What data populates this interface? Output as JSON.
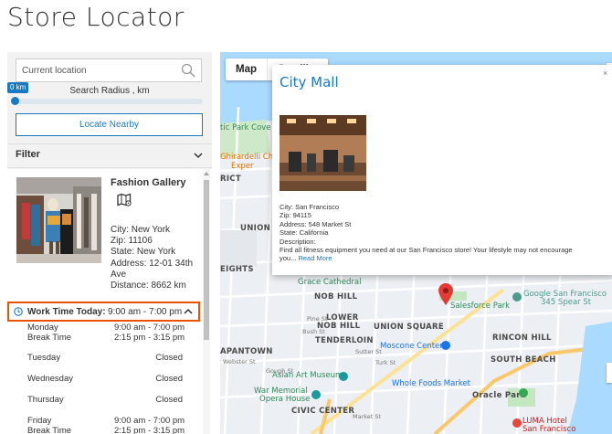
{
  "page": {
    "title": "Store Locator"
  },
  "search": {
    "placeholder": "Current location",
    "radius_value": "0 km",
    "radius_label": "Search Radius , km",
    "radius_fraction": 0.0,
    "locate_button": "Locate Nearby"
  },
  "filter": {
    "label": "Filter"
  },
  "store": {
    "name": "Fashion Gallery",
    "city": "City: New York",
    "zip": "Zip: 11106",
    "state": "State: New York",
    "address": "Address: 12-01 34th Ave",
    "distance": "Distance: 8662 km",
    "work_today_label": "Work Time Today:",
    "work_today_value": "9:00 am - 7:00 pm",
    "schedule": [
      {
        "day": "Monday",
        "hours": "9:00 am - 7:00 pm",
        "break_label": "Break Time",
        "break": "2:15 pm - 3:15 pm"
      },
      {
        "day": "Tuesday",
        "hours": "Closed"
      },
      {
        "day": "Wednesday",
        "hours": "Closed"
      },
      {
        "day": "Thursday",
        "hours": "Closed"
      },
      {
        "day": "Friday",
        "hours": "9:00 am - 7:00 pm",
        "break_label": "Break Time",
        "break": "2:15 pm - 3:15 pm"
      }
    ]
  },
  "map": {
    "tabs": [
      "Map",
      "Satellite"
    ],
    "info_window": {
      "title": "City Mall",
      "close": "×",
      "city": "City: San Francisco",
      "zip": "Zip: 94115",
      "address": "Address: 548 Market St",
      "state": "State: California",
      "description_label": "Description:",
      "description": "Find all fitness equipment you need at our San Francisco store! Your lifestyle may not encourage",
      "description_end": "you...",
      "read_more": "Read More"
    },
    "labels": {
      "palace": "tic Park Cove",
      "ghirardelli": "Ghirardelli Choc",
      "exp": "Exper",
      "rict": "RICT",
      "union": "UNION S",
      "heights": "EIGHTS",
      "cathedral": "Grace Cathedral",
      "nob_hill": "NOB HILL",
      "lower_nob_hill_1": "LOWER",
      "lower_nob_hill_2": "NOB HILL",
      "union_square": "UNION SQUARE",
      "tenderloin": "TENDERLOIN",
      "rincon_hill": "RINCON HILL",
      "salesforce": "Salesforce Park",
      "google_sf_1": "Google San Francisco",
      "google_sf_2": "345 Spear St",
      "moscone": "Moscone Center",
      "japantown": "APANTOWN",
      "south_beach": "SOUTH BEACH",
      "asian_art": "Asian Art Museum",
      "war_memorial_1": "War Memorial",
      "war_memorial_2": "Opera House",
      "whole_foods": "Whole Foods Market",
      "oracle_park": "Oracle Park",
      "civic_center": "CIVIC CENTER",
      "luma_1": "LUMA Hotel",
      "luma_2": "San Francisco",
      "pine_st": "Pine St",
      "bush_st": "Bush St",
      "sutter_st": "Sutter St",
      "turk_st": "Turk St",
      "webster_st": "Webster St",
      "gough_st": "Gough St",
      "market_st": "Market St"
    }
  }
}
